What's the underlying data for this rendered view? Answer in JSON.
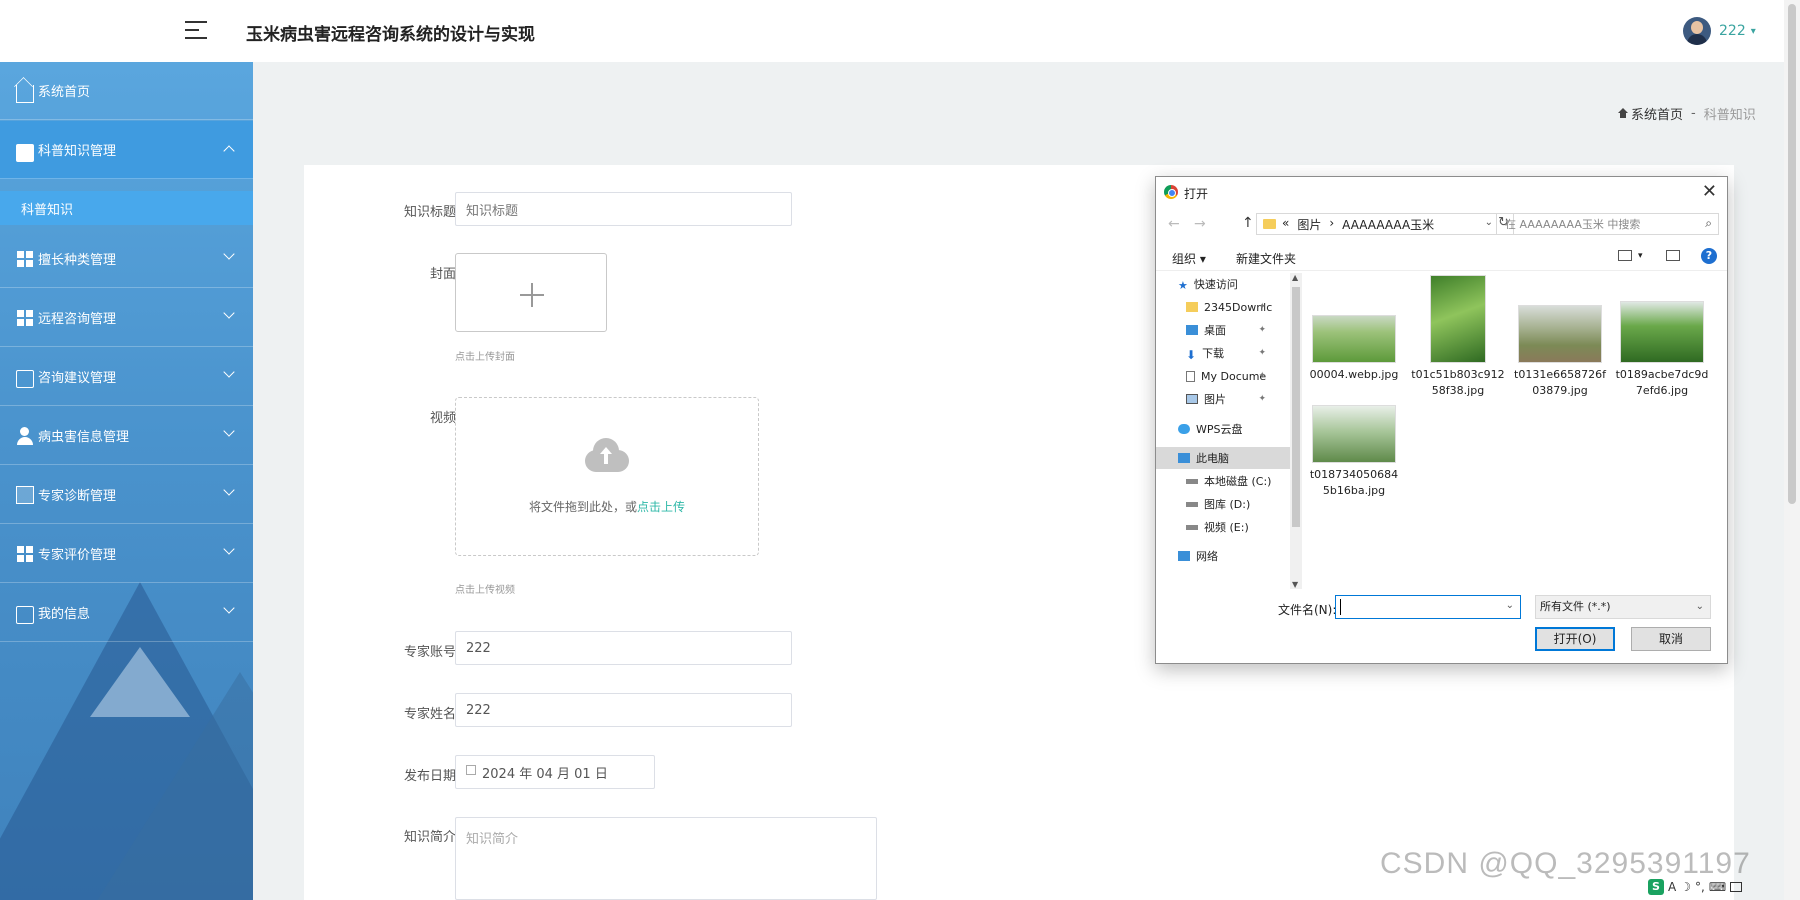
{
  "header": {
    "title": "玉米病虫害远程咨询系统的设计与实现",
    "user_name": "222",
    "caret": "▾"
  },
  "sidebar": {
    "items": [
      {
        "label": "系统首页",
        "icon": "home-icon",
        "active": false,
        "expanded": false
      },
      {
        "label": "科普知识管理",
        "icon": "briefcase-icon",
        "active": true,
        "expanded": true
      },
      {
        "label": "擅长种类管理",
        "icon": "grid-icon",
        "active": false,
        "expanded": false
      },
      {
        "label": "远程咨询管理",
        "icon": "grid-icon",
        "active": false,
        "expanded": false
      },
      {
        "label": "咨询建议管理",
        "icon": "wallet-icon",
        "active": false,
        "expanded": false
      },
      {
        "label": "病虫害信息管理",
        "icon": "user-icon",
        "active": false,
        "expanded": false
      },
      {
        "label": "专家诊断管理",
        "icon": "clipboard-icon",
        "active": false,
        "expanded": false
      },
      {
        "label": "专家评价管理",
        "icon": "grid-icon",
        "active": false,
        "expanded": false
      },
      {
        "label": "我的信息",
        "icon": "card-icon",
        "active": false,
        "expanded": false
      }
    ],
    "submenu": {
      "label": "科普知识"
    }
  },
  "breadcrumb": {
    "home": "系统首页",
    "separator": "-",
    "current": "科普知识"
  },
  "form": {
    "title_label": "知识标题",
    "title_placeholder": "知识标题",
    "cover_label": "封面",
    "cover_hint": "点击上传封面",
    "video_label": "视频",
    "video_drop_text": "将文件拖到此处，或",
    "video_drop_link": "点击上传",
    "video_hint": "点击上传视频",
    "account_label": "专家账号",
    "account_value": "222",
    "name_label": "专家姓名",
    "name_value": "222",
    "date_label": "发布日期",
    "date_value": "2024 年 04 月 01 日",
    "intro_label": "知识简介",
    "intro_placeholder": "知识简介"
  },
  "dialog": {
    "title": "打开",
    "close": "✕",
    "back": "←",
    "forward": "→",
    "up": "↑",
    "path": [
      "«",
      "图片",
      "›",
      "AAAAAAAA玉米"
    ],
    "refresh": "↻",
    "search_placeholder": "在 AAAAAAAA玉米 中搜索",
    "search_glyph": "⌕",
    "organize": "组织 ▾",
    "new_folder": "新建文件夹",
    "view_caret": "▾",
    "help": "?",
    "tree": [
      {
        "label": "快速访问",
        "icon": "star-icon",
        "pinned": false,
        "selected": false
      },
      {
        "label": "2345Downlc",
        "icon": "folder-icon",
        "pinned": true,
        "selected": false
      },
      {
        "label": "桌面",
        "icon": "desktop-icon",
        "pinned": true,
        "selected": false
      },
      {
        "label": "下载",
        "icon": "download-icon",
        "pinned": true,
        "selected": false
      },
      {
        "label": "My Docume",
        "icon": "document-icon",
        "pinned": true,
        "selected": false
      },
      {
        "label": "图片",
        "icon": "pictures-icon",
        "pinned": true,
        "selected": false
      },
      {
        "label": "WPS云盘",
        "icon": "cloud-icon",
        "pinned": false,
        "selected": false
      },
      {
        "label": "此电脑",
        "icon": "computer-icon",
        "pinned": false,
        "selected": true
      },
      {
        "label": "本地磁盘 (C:)",
        "icon": "drive-icon",
        "pinned": false,
        "selected": false
      },
      {
        "label": "图库 (D:)",
        "icon": "drive-icon",
        "pinned": false,
        "selected": false
      },
      {
        "label": "视频 (E:)",
        "icon": "drive-icon",
        "pinned": false,
        "selected": false
      },
      {
        "label": "网络",
        "icon": "network-icon",
        "pinned": false,
        "selected": false
      }
    ],
    "pin_glyph": "📌",
    "files": [
      {
        "name": "00004.webp.jpg"
      },
      {
        "name": "t01c51b803c91258f38.jpg"
      },
      {
        "name": "t0131e6658726f03879.jpg"
      },
      {
        "name": "t0189acbe7dc9d7efd6.jpg"
      },
      {
        "name": "t0187340506845b16ba.jpg"
      }
    ],
    "filename_label": "文件名(N):",
    "filetype": "所有文件 (*.*)",
    "dropdown_glyph": "⌄",
    "open_button": "打开(O)",
    "cancel_button": "取消"
  },
  "watermark": "CSDN @QQ_3295391197",
  "tray": {
    "s": "S",
    "a": "A",
    "moon": "☽",
    "comma": "°,",
    "keyboard": "⌨"
  }
}
